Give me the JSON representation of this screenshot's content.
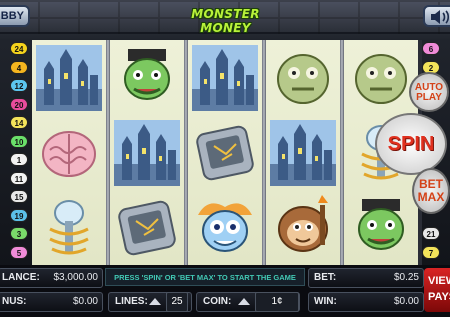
{
  "header": {
    "lobby_label": "BBY",
    "title": "MONSTER MONEY",
    "sound_icon": "speaker-icon"
  },
  "left_lines": [
    "24",
    "4",
    "12",
    "20",
    "14",
    "10",
    "1",
    "11",
    "15",
    "19",
    "3",
    "5"
  ],
  "right_lines": [
    "6",
    "2",
    "",
    "",
    "",
    "",
    "",
    "",
    "",
    "",
    "21",
    "7"
  ],
  "left_colors": [
    "#f4d21c",
    "#f5b51f",
    "#5cc6f0",
    "#e84c9c",
    "#f3e35a",
    "#6ae06a",
    "#f2f2f2",
    "#f2f2f2",
    "#e8e8e8",
    "#5cc0e8",
    "#7adb6a",
    "#f08bd8"
  ],
  "right_colors": [
    "#f08bd8",
    "#f3e35a",
    "#ffffff",
    "#ffffff",
    "#ffffff",
    "#ffffff",
    "#ffffff",
    "#ffffff",
    "#ffffff",
    "#ffffff",
    "#e8e8e8",
    "#f3e35a"
  ],
  "reels": [
    [
      "castle",
      "brain",
      "slime-pillar"
    ],
    [
      "frankenstein",
      "castle",
      "tablet"
    ],
    [
      "castle",
      "tablet",
      "mad-scientist"
    ],
    [
      "zombie",
      "castle",
      "monkey"
    ],
    [
      "zombie",
      "slime-pillar",
      "frankenstein"
    ]
  ],
  "buttons": {
    "auto_play": "AUTO PLAY",
    "spin": "SPIN",
    "bet_max": "BET MAX",
    "view_pays": "VIEW PAYS"
  },
  "bottom": {
    "balance_label": "LANCE:",
    "balance_value": "$3,000.00",
    "bonus_label": "NUS:",
    "bonus_value": "$0.00",
    "message": "PRESS 'SPIN' OR 'BET MAX' TO START THE GAME",
    "lines_label": "LINES:",
    "lines_value": "25",
    "coin_label": "COIN:",
    "coin_value": "1¢",
    "bet_label": "BET:",
    "bet_value": "$0.25",
    "win_label": "WIN:",
    "win_value": "$0.00"
  },
  "colors": {
    "accent_green": "#b8f23a",
    "spin_red": "#e0301e",
    "message_cyan": "#42c8b4",
    "pays_red": "#d92424"
  }
}
